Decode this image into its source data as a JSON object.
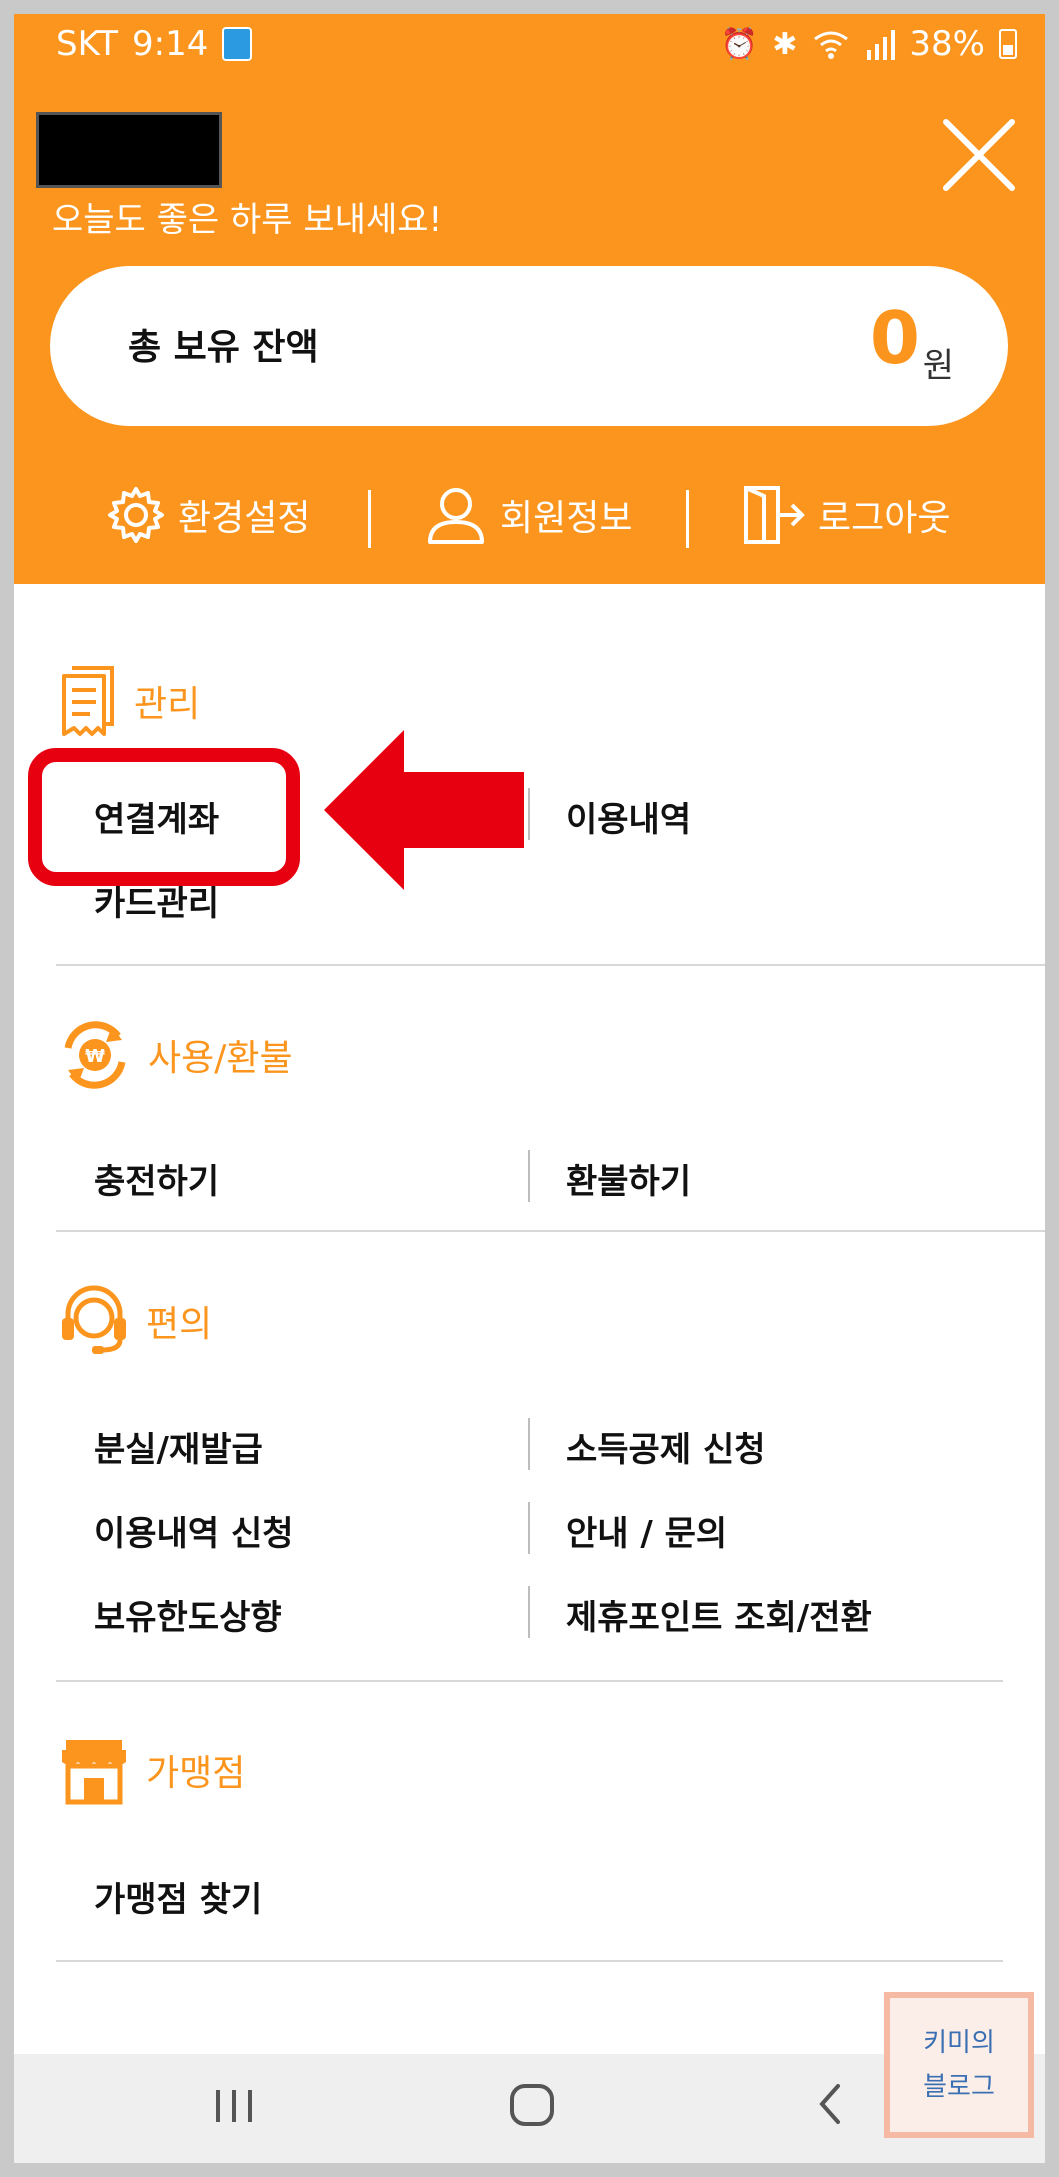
{
  "status": {
    "carrier": "SKT",
    "time": "9:14",
    "battery": "38%"
  },
  "header": {
    "greeting": "오늘도 좋은 하루 보내세요!",
    "balance_label": "총 보유 잔액",
    "balance_value": "0",
    "balance_unit": "원",
    "quick": [
      {
        "label": "환경설정",
        "icon": "gear-icon"
      },
      {
        "label": "회원정보",
        "icon": "person-icon"
      },
      {
        "label": "로그아웃",
        "icon": "logout-icon"
      }
    ]
  },
  "sections": {
    "manage": {
      "title": "관리",
      "items": [
        "연결계좌",
        "이용내역",
        "카드관리"
      ]
    },
    "use_refund": {
      "title": "사용/환불",
      "items": [
        "충전하기",
        "환불하기"
      ]
    },
    "convenience": {
      "title": "편의",
      "items": [
        "분실/재발급",
        "소득공제 신청",
        "이용내역 신청",
        "안내 / 문의",
        "보유한도상향",
        "제휴포인트 조회/전환"
      ]
    },
    "merchant": {
      "title": "가맹점",
      "items": [
        "가맹점 찾기"
      ]
    }
  },
  "watermark": {
    "line1": "키미의",
    "line2": "블로그"
  },
  "colors": {
    "accent": "#FB951E",
    "highlight": "#E60010"
  }
}
